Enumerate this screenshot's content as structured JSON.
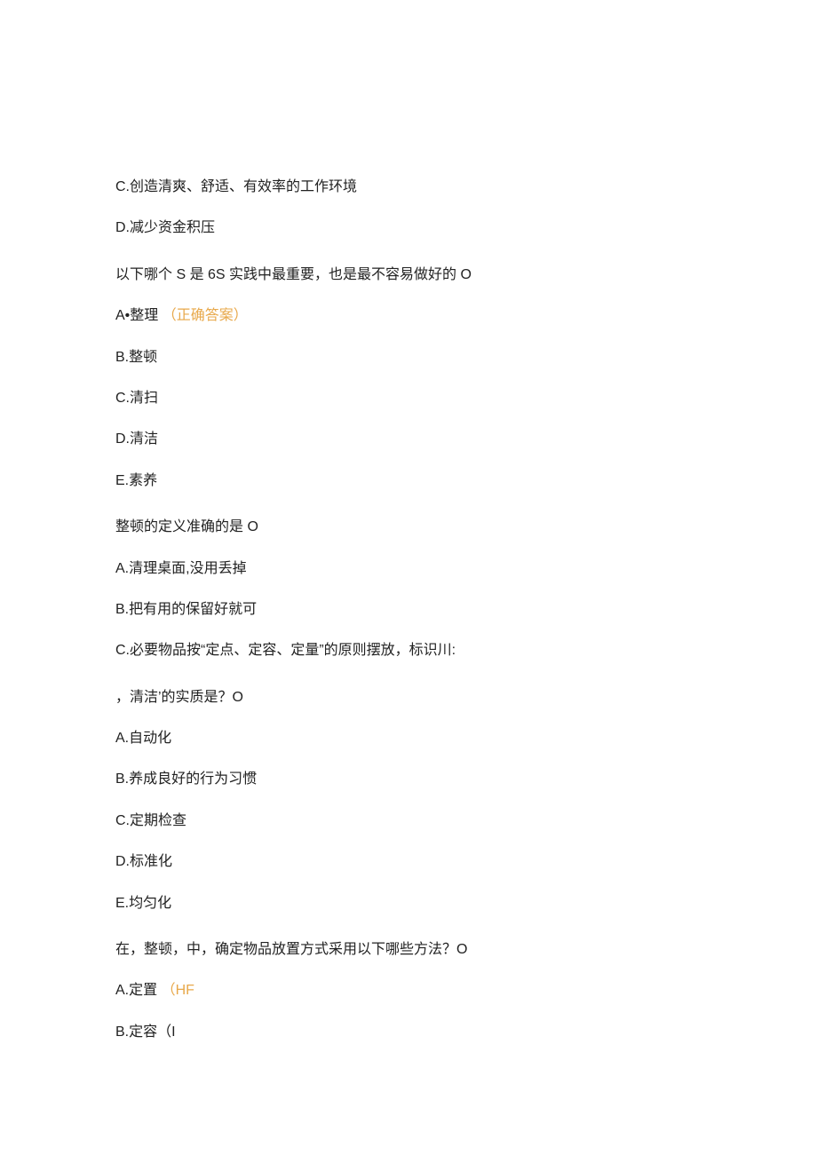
{
  "block1": {
    "optionC": "C.创造清爽、舒适、有效率的工作环境",
    "optionD": "D.减少资金积压"
  },
  "block2": {
    "question": "以下哪个 S 是 6S 实践中最重要，也是最不容易做好的 O",
    "optA_prefix": "A•整理",
    "optA_correct": "（正确答案）",
    "optB": "B.整顿",
    "optC": "C.清扫",
    "optD": "D.清洁",
    "optE": "E.素养"
  },
  "block3": {
    "question": "整顿的定义准确的是 O",
    "optA": "A.清理桌面,没用丢掉",
    "optB": "B.把有用的保留好就可",
    "optC": "C.必要物品按“定点、定容、定量”的原则摆放，标识川:"
  },
  "block4": {
    "question": "，清洁’的实质是？O",
    "optA": "A.自动化",
    "optB": "B.养成良好的行为习惯",
    "optC": "C.定期检查",
    "optD": "D.标准化",
    "optE": "E.均匀化"
  },
  "block5": {
    "question": "在，整顿，中，确定物品放置方式采用以下哪些方法？O",
    "optA_prefix": "A.定置",
    "optA_note": "（HF",
    "optB": "B.定容（I"
  }
}
